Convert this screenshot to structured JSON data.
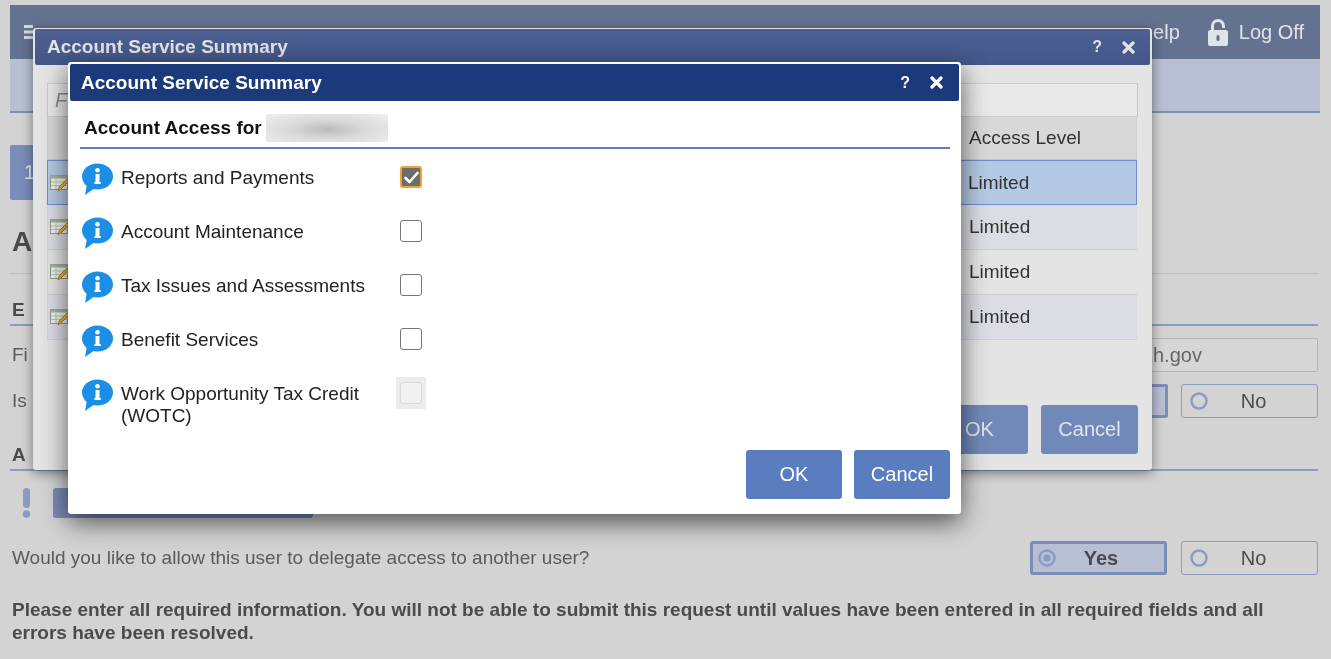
{
  "header": {
    "help_link": "elp",
    "logoff_link": "Log Off"
  },
  "step_tab": {
    "label": "1"
  },
  "content": {
    "heading": "A",
    "section_1": {
      "heading": "E",
      "field": {
        "label": "Fi",
        "value": "h.gov"
      },
      "question": {
        "label": "Is",
        "options": [
          {
            "selected": true
          },
          {
            "label": "No",
            "selected": false
          }
        ]
      }
    },
    "section_2": {
      "heading": "A",
      "question": {
        "label": "Would you like to allow this user to delegate access to another user?",
        "options": [
          {
            "label": "Yes",
            "selected": true
          },
          {
            "label": "No",
            "selected": false
          }
        ]
      }
    },
    "notice": "Please enter all required information. You will not be able to submit this request until values have been entered in all required fields and all errors have been resolved."
  },
  "back_dialog": {
    "title": "Account Service Summary",
    "help": "?",
    "filter": {
      "placeholder": "F"
    },
    "table": {
      "column_header": "Access Level",
      "rows": [
        {
          "access_level": "Limited",
          "selected": true
        },
        {
          "access_level": "Limited",
          "selected": false
        },
        {
          "access_level": "Limited",
          "selected": false
        },
        {
          "access_level": "Limited",
          "selected": false
        }
      ]
    },
    "buttons": [
      {
        "label": "OK"
      },
      {
        "label": "Cancel"
      }
    ]
  },
  "front_dialog": {
    "title": "Account Service Summary",
    "help": "?",
    "heading": "Account Access for",
    "items": [
      {
        "label": "Reports and Payments",
        "checked": true,
        "focused": true,
        "disabled": false
      },
      {
        "label": "Account Maintenance",
        "checked": false,
        "focused": false,
        "disabled": false
      },
      {
        "label": "Tax Issues and Assessments",
        "checked": false,
        "focused": false,
        "disabled": false
      },
      {
        "label": "Benefit Services",
        "checked": false,
        "focused": false,
        "disabled": false
      },
      {
        "label": "Work Opportunity Tax Credit (WOTC)",
        "checked": false,
        "focused": false,
        "disabled": true
      }
    ],
    "buttons": [
      {
        "label": "OK"
      },
      {
        "label": "Cancel"
      }
    ]
  }
}
